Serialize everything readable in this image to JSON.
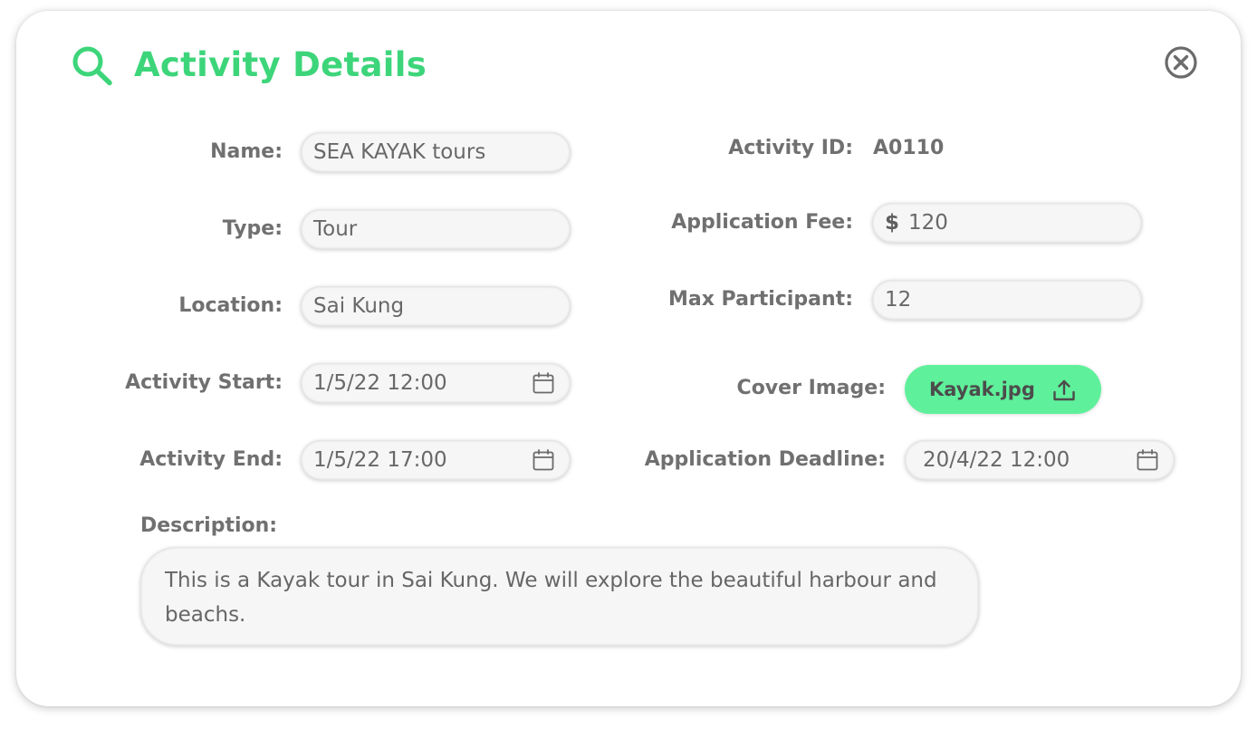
{
  "dialog": {
    "title": "Activity Details",
    "title_icon": "search-icon",
    "close_icon": "close-circle-icon",
    "accent_color": "#3dd57a"
  },
  "fields": {
    "name": {
      "label": "Name:",
      "value": "SEA KAYAK tours"
    },
    "type": {
      "label": "Type:",
      "value": "Tour"
    },
    "location": {
      "label": "Location:",
      "value": "Sai Kung"
    },
    "activity_start": {
      "label": "Activity Start:",
      "value": "1/5/22 12:00",
      "icon": "calendar-icon"
    },
    "activity_end": {
      "label": "Activity End:",
      "value": "1/5/22 17:00",
      "icon": "calendar-icon"
    },
    "activity_id": {
      "label": "Activity ID:",
      "value": "A0110"
    },
    "application_fee": {
      "label": "Application Fee:",
      "currency": "$",
      "value": "120"
    },
    "max_participant": {
      "label": "Max Participant:",
      "value": "12"
    },
    "cover_image": {
      "label": "Cover Image:",
      "file_name": "Kayak.jpg",
      "icon": "upload-icon",
      "button_color": "#5ff09b"
    },
    "application_deadline": {
      "label": "Application Deadline:",
      "value": "20/4/22 12:00",
      "icon": "calendar-icon"
    },
    "description": {
      "label": "Description:",
      "value": "This is a Kayak tour in Sai Kung. We will explore the beautiful harbour and beachs."
    }
  }
}
